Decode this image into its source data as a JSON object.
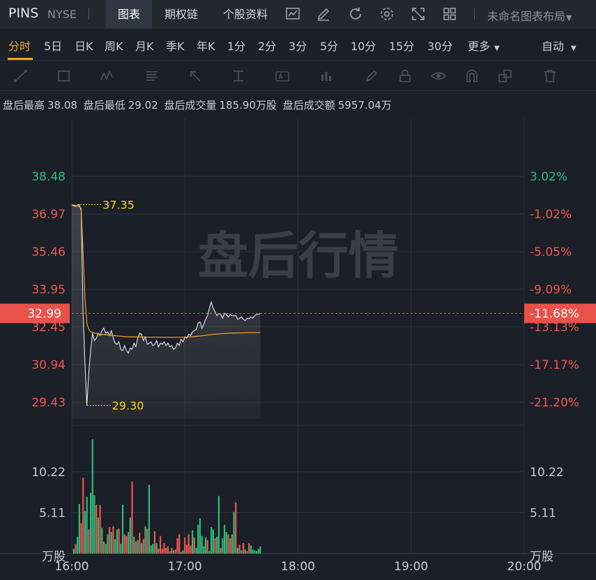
{
  "header": {
    "ticker": "PINS",
    "exchange": "NYSE",
    "tabs": [
      {
        "label": "图表",
        "active": true
      },
      {
        "label": "期权链",
        "active": false
      },
      {
        "label": "个股资料",
        "active": false
      }
    ],
    "toolbar_icons": [
      "chart-analysis-icon",
      "edit-icon",
      "refresh-icon",
      "settings-icon",
      "fullscreen-icon",
      "grid-layout-icon"
    ],
    "layout_label": "未命名图表布局"
  },
  "periods": {
    "items": [
      "分时",
      "5日",
      "日K",
      "周K",
      "月K",
      "季K",
      "年K",
      "1分",
      "2分",
      "3分",
      "5分",
      "10分",
      "15分",
      "30分",
      "更多"
    ],
    "active": "分时",
    "mode": "自动"
  },
  "drawing_tools": [
    "line-tool-icon",
    "rect-tool-icon",
    "wave-tool-icon",
    "fib-tool-icon",
    "arrow-tool-icon",
    "measure-tool-icon",
    "text-tool-icon",
    "volume-tool-icon",
    "brush-icon",
    "lock-icon",
    "eye-icon",
    "magnet-icon",
    "layers-icon",
    "trash-icon"
  ],
  "info": {
    "high_label": "盘后最高",
    "high_value": "38.08",
    "low_label": "盘后最低",
    "low_value": "29.02",
    "volume_label": "盘后成交量",
    "volume_value": "185.90万股",
    "turnover_label": "盘后成交额",
    "turnover_value": "5957.04万"
  },
  "colors": {
    "up": "#2dbd7e",
    "down": "#f0574f",
    "price_line": "#e6e8eb",
    "avg_line": "#e89a2c",
    "marker": "#f5d90a",
    "current_bg": "#e9524a"
  },
  "chart_data": {
    "type": "line",
    "watermark": "盘后行情",
    "x_ticks": [
      "16:00",
      "17:00",
      "18:00",
      "19:00",
      "20:00"
    ],
    "price_ticks": [
      {
        "value": 38.48,
        "label": "38.48",
        "pct": "3.02%"
      },
      {
        "value": 36.97,
        "label": "36.97",
        "pct": "-1.02%"
      },
      {
        "value": 35.46,
        "label": "35.46",
        "pct": "-5.05%"
      },
      {
        "value": 33.95,
        "label": "33.95",
        "pct": "-9.09%"
      },
      {
        "value": 32.45,
        "label": "32.45",
        "pct": "-13.13%"
      },
      {
        "value": 30.94,
        "label": "30.94",
        "pct": "-17.17%"
      },
      {
        "value": 29.43,
        "label": "29.43",
        "pct": "-21.20%"
      }
    ],
    "price_range": [
      29.43,
      38.48
    ],
    "current_price": {
      "value": 32.99,
      "label": "32.99",
      "pct": "-11.68%"
    },
    "high_marker": {
      "value": 37.35,
      "label": "37.35",
      "time": 3
    },
    "low_marker": {
      "value": 29.3,
      "label": "29.30",
      "time": 8
    },
    "volume_ticks": [
      {
        "value": 10.22,
        "label": "10.22"
      },
      {
        "value": 5.11,
        "label": "5.11"
      }
    ],
    "volume_unit": "万股",
    "volume_max": 14.4,
    "time_range_minutes": [
      0,
      240
    ],
    "price_series": {
      "name": "价格",
      "points": [
        [
          0,
          37.35
        ],
        [
          1,
          37.3
        ],
        [
          2,
          37.28
        ],
        [
          3,
          37.32
        ],
        [
          4,
          37.35
        ],
        [
          5,
          37.1
        ],
        [
          6,
          33.0
        ],
        [
          7,
          31.0
        ],
        [
          8,
          29.3
        ],
        [
          9,
          30.6
        ],
        [
          10,
          31.5
        ],
        [
          11,
          32.2
        ],
        [
          12,
          31.9
        ],
        [
          13,
          32.0
        ],
        [
          14,
          32.2
        ],
        [
          15,
          32.1
        ],
        [
          16,
          32.3
        ],
        [
          17,
          32.4
        ],
        [
          18,
          32.2
        ],
        [
          19,
          32.25
        ],
        [
          20,
          32.1
        ],
        [
          21,
          32.3
        ],
        [
          22,
          32.0
        ],
        [
          23,
          31.8
        ],
        [
          24,
          31.75
        ],
        [
          25,
          31.85
        ],
        [
          26,
          31.55
        ],
        [
          27,
          31.5
        ],
        [
          28,
          31.7
        ],
        [
          29,
          31.5
        ],
        [
          30,
          31.4
        ],
        [
          31,
          31.6
        ],
        [
          32,
          31.55
        ],
        [
          33,
          31.8
        ],
        [
          34,
          31.65
        ],
        [
          35,
          32.0
        ],
        [
          36,
          32.2
        ],
        [
          37,
          32.15
        ],
        [
          38,
          31.9
        ],
        [
          39,
          32.05
        ],
        [
          40,
          31.75
        ],
        [
          41,
          31.8
        ],
        [
          42,
          31.85
        ],
        [
          43,
          31.7
        ],
        [
          44,
          31.75
        ],
        [
          45,
          31.9
        ],
        [
          46,
          31.65
        ],
        [
          47,
          31.8
        ],
        [
          48,
          31.75
        ],
        [
          49,
          31.85
        ],
        [
          50,
          31.7
        ],
        [
          51,
          31.8
        ],
        [
          52,
          31.65
        ],
        [
          53,
          31.7
        ],
        [
          54,
          31.55
        ],
        [
          55,
          31.6
        ],
        [
          56,
          31.8
        ],
        [
          57,
          31.7
        ],
        [
          58,
          31.95
        ],
        [
          59,
          31.85
        ],
        [
          60,
          32.05
        ],
        [
          61,
          32.0
        ],
        [
          62,
          32.15
        ],
        [
          63,
          32.1
        ],
        [
          64,
          32.25
        ],
        [
          65,
          32.3
        ],
        [
          66,
          32.35
        ],
        [
          67,
          32.6
        ],
        [
          68,
          32.65
        ],
        [
          69,
          32.4
        ],
        [
          70,
          32.55
        ],
        [
          71,
          32.75
        ],
        [
          72,
          32.9
        ],
        [
          73,
          33.2
        ],
        [
          74,
          33.45
        ],
        [
          75,
          33.2
        ],
        [
          76,
          33.05
        ],
        [
          77,
          32.9
        ],
        [
          78,
          33.0
        ],
        [
          79,
          32.95
        ],
        [
          80,
          32.8
        ],
        [
          81,
          33.0
        ],
        [
          82,
          32.95
        ],
        [
          83,
          32.85
        ],
        [
          84,
          32.95
        ],
        [
          85,
          32.9
        ],
        [
          86,
          32.9
        ],
        [
          87,
          32.9
        ],
        [
          88,
          32.75
        ],
        [
          89,
          32.8
        ],
        [
          90,
          32.85
        ],
        [
          91,
          32.75
        ],
        [
          92,
          32.7
        ],
        [
          93,
          32.8
        ],
        [
          94,
          32.78
        ],
        [
          95,
          32.85
        ],
        [
          96,
          32.8
        ],
        [
          97,
          32.9
        ],
        [
          98,
          32.95
        ],
        [
          99,
          32.95
        ],
        [
          100,
          32.99
        ]
      ]
    },
    "avg_series": {
      "name": "均价",
      "points": [
        [
          0,
          37.35
        ],
        [
          3,
          37.3
        ],
        [
          5,
          37.2
        ],
        [
          6,
          35.4
        ],
        [
          7,
          33.6
        ],
        [
          8,
          32.6
        ],
        [
          9,
          32.35
        ],
        [
          10,
          32.25
        ],
        [
          12,
          32.2
        ],
        [
          15,
          32.15
        ],
        [
          20,
          32.12
        ],
        [
          25,
          32.08
        ],
        [
          30,
          32.05
        ],
        [
          35,
          32.05
        ],
        [
          40,
          32.04
        ],
        [
          45,
          32.04
        ],
        [
          50,
          32.03
        ],
        [
          55,
          32.03
        ],
        [
          60,
          32.04
        ],
        [
          65,
          32.06
        ],
        [
          70,
          32.1
        ],
        [
          75,
          32.15
        ],
        [
          80,
          32.18
        ],
        [
          85,
          32.2
        ],
        [
          90,
          32.21
        ],
        [
          95,
          32.22
        ],
        [
          100,
          32.22
        ]
      ]
    },
    "volume_series": {
      "name": "成交量",
      "bars": [
        [
          1,
          0.6,
          "up"
        ],
        [
          2,
          1.2,
          "down"
        ],
        [
          3,
          2.1,
          "up"
        ],
        [
          4,
          6.2,
          "up"
        ],
        [
          5,
          3.8,
          "down"
        ],
        [
          6,
          9.5,
          "down"
        ],
        [
          7,
          5.3,
          "up"
        ],
        [
          8,
          7.1,
          "up"
        ],
        [
          9,
          3.0,
          "down"
        ],
        [
          10,
          7.6,
          "up"
        ],
        [
          11,
          14.3,
          "up"
        ],
        [
          12,
          7.3,
          "up"
        ],
        [
          13,
          6.1,
          "down"
        ],
        [
          14,
          4.5,
          "up"
        ],
        [
          15,
          6.1,
          "down"
        ],
        [
          16,
          3.2,
          "up"
        ],
        [
          17,
          1.5,
          "down"
        ],
        [
          18,
          1.2,
          "up"
        ],
        [
          19,
          2.4,
          "up"
        ],
        [
          20,
          3.3,
          "down"
        ],
        [
          21,
          2.7,
          "up"
        ],
        [
          22,
          3.4,
          "down"
        ],
        [
          23,
          1.8,
          "up"
        ],
        [
          24,
          3.0,
          "up"
        ],
        [
          25,
          3.1,
          "down"
        ],
        [
          26,
          1.2,
          "up"
        ],
        [
          27,
          6.1,
          "up"
        ],
        [
          28,
          2.4,
          "down"
        ],
        [
          29,
          2.2,
          "down"
        ],
        [
          30,
          2.7,
          "up"
        ],
        [
          31,
          4.5,
          "up"
        ],
        [
          32,
          9.0,
          "down"
        ],
        [
          33,
          2.1,
          "up"
        ],
        [
          34,
          1.5,
          "down"
        ],
        [
          35,
          1.7,
          "up"
        ],
        [
          36,
          2.6,
          "down"
        ],
        [
          37,
          1.3,
          "up"
        ],
        [
          38,
          1.8,
          "down"
        ],
        [
          39,
          3.4,
          "up"
        ],
        [
          40,
          3.1,
          "down"
        ],
        [
          41,
          8.6,
          "up"
        ],
        [
          42,
          1.0,
          "up"
        ],
        [
          43,
          1.2,
          "up"
        ],
        [
          44,
          2.8,
          "down"
        ],
        [
          45,
          1.3,
          "up"
        ],
        [
          46,
          0.6,
          "down"
        ],
        [
          47,
          2.2,
          "down"
        ],
        [
          48,
          0.6,
          "down"
        ],
        [
          49,
          1.3,
          "down"
        ],
        [
          50,
          0.7,
          "down"
        ],
        [
          51,
          0.9,
          "down"
        ],
        [
          52,
          0.3,
          "up"
        ],
        [
          53,
          0.7,
          "down"
        ],
        [
          54,
          0.4,
          "up"
        ],
        [
          55,
          0.5,
          "down"
        ],
        [
          56,
          1.9,
          "down"
        ],
        [
          57,
          2.4,
          "down"
        ],
        [
          58,
          0.2,
          "up"
        ],
        [
          59,
          0.4,
          "up"
        ],
        [
          60,
          2.0,
          "down"
        ],
        [
          61,
          1.1,
          "down"
        ],
        [
          62,
          2.4,
          "down"
        ],
        [
          63,
          1.0,
          "down"
        ],
        [
          64,
          2.9,
          "up"
        ],
        [
          65,
          2.0,
          "down"
        ],
        [
          66,
          0.7,
          "up"
        ],
        [
          67,
          3.6,
          "up"
        ],
        [
          68,
          4.4,
          "up"
        ],
        [
          69,
          2.2,
          "up"
        ],
        [
          70,
          0.9,
          "up"
        ],
        [
          71,
          2.0,
          "up"
        ],
        [
          72,
          1.7,
          "down"
        ],
        [
          73,
          0.3,
          "up"
        ],
        [
          74,
          3.3,
          "up"
        ],
        [
          75,
          3.0,
          "up"
        ],
        [
          76,
          1.9,
          "down"
        ],
        [
          77,
          2.1,
          "up"
        ],
        [
          78,
          7.2,
          "up"
        ],
        [
          79,
          0.7,
          "down"
        ],
        [
          80,
          1.9,
          "up"
        ],
        [
          81,
          3.6,
          "up"
        ],
        [
          82,
          2.7,
          "up"
        ],
        [
          83,
          2.4,
          "down"
        ],
        [
          84,
          1.9,
          "down"
        ],
        [
          85,
          2.4,
          "up"
        ],
        [
          86,
          5.2,
          "up"
        ],
        [
          87,
          6.4,
          "down"
        ],
        [
          88,
          0.7,
          "up"
        ],
        [
          89,
          1.1,
          "down"
        ],
        [
          90,
          0.4,
          "up"
        ],
        [
          91,
          1.3,
          "down"
        ],
        [
          92,
          0.5,
          "up"
        ],
        [
          93,
          0.3,
          "down"
        ],
        [
          94,
          1.3,
          "down"
        ],
        [
          95,
          1.0,
          "up"
        ],
        [
          96,
          0.5,
          "up"
        ],
        [
          97,
          0.4,
          "up"
        ],
        [
          98,
          0.3,
          "up"
        ],
        [
          99,
          0.6,
          "up"
        ],
        [
          100,
          0.9,
          "up"
        ]
      ]
    }
  }
}
